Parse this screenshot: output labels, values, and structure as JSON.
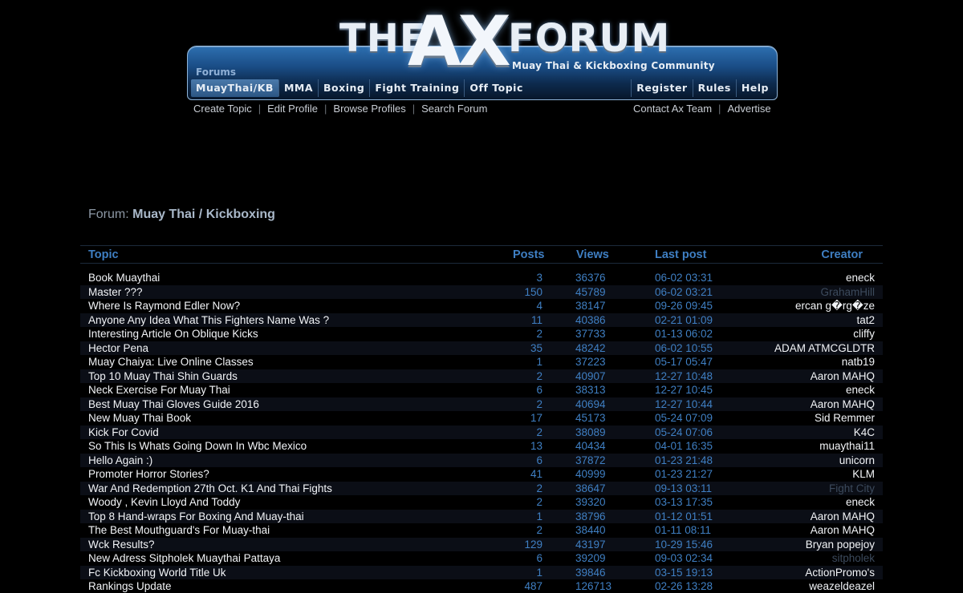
{
  "header": {
    "logo_the": "THE",
    "logo_ax": "AX",
    "logo_forum": "FORUM",
    "tagline": "Muay Thai & Kickboxing Community",
    "forums_label": "Forums",
    "nav_left": [
      "MuayThai/KB",
      "MMA",
      "Boxing",
      "Fight Training",
      "Off Topic"
    ],
    "nav_right": [
      "Register",
      "Rules",
      "Help"
    ],
    "active_nav": "MuayThai/KB"
  },
  "sublinks": {
    "left": [
      "Create Topic",
      "Edit Profile",
      "Browse Profiles",
      "Search Forum"
    ],
    "right": [
      "Contact Ax Team",
      "Advertise"
    ],
    "separator": "|"
  },
  "forum": {
    "prefix": "Forum: ",
    "name": "Muay Thai / Kickboxing"
  },
  "table": {
    "headers": {
      "topic": "Topic",
      "posts": "Posts",
      "views": "Views",
      "last_post": "Last post",
      "creator": "Creator"
    },
    "rows": [
      {
        "topic": "Book Muaythai",
        "posts": "3",
        "views": "36376",
        "last_post": "06-02 03:31",
        "creator": "eneck",
        "dim": false
      },
      {
        "topic": "Master ???",
        "posts": "150",
        "views": "45789",
        "last_post": "06-02 03:21",
        "creator": "GrahamHill",
        "dim": true
      },
      {
        "topic": "Where Is Raymond Edler Now?",
        "posts": "4",
        "views": "38147",
        "last_post": "09-26 09:45",
        "creator": "ercan g�rg�ze",
        "dim": false
      },
      {
        "topic": "Anyone Any Idea What This Fighters Name Was ?",
        "posts": "11",
        "views": "40386",
        "last_post": "02-21 01:09",
        "creator": "tat2",
        "dim": false
      },
      {
        "topic": "Interesting Article On Oblique Kicks",
        "posts": "2",
        "views": "37733",
        "last_post": "01-13 06:02",
        "creator": "cliffy",
        "dim": false
      },
      {
        "topic": "Hector Pena",
        "posts": "35",
        "views": "48242",
        "last_post": "06-02 10:55",
        "creator": "ADAM ATMCGLDTR",
        "dim": false
      },
      {
        "topic": "Muay Chaiya: Live Online Classes",
        "posts": "1",
        "views": "37223",
        "last_post": "05-17 05:47",
        "creator": "natb19",
        "dim": false
      },
      {
        "topic": "Top 10 Muay Thai Shin Guards",
        "posts": "2",
        "views": "40907",
        "last_post": "12-27 10:48",
        "creator": "Aaron MAHQ",
        "dim": false
      },
      {
        "topic": "Neck Exercise For Muay Thai",
        "posts": "6",
        "views": "38313",
        "last_post": "12-27 10:45",
        "creator": "eneck",
        "dim": false
      },
      {
        "topic": "Best Muay Thai Gloves Guide 2016",
        "posts": "2",
        "views": "40694",
        "last_post": "12-27 10:44",
        "creator": "Aaron MAHQ",
        "dim": false
      },
      {
        "topic": "New Muay Thai Book",
        "posts": "17",
        "views": "45173",
        "last_post": "05-24 07:09",
        "creator": "Sid Remmer",
        "dim": false
      },
      {
        "topic": "Kick For Covid",
        "posts": "2",
        "views": "38089",
        "last_post": "05-24 07:06",
        "creator": "K4C",
        "dim": false
      },
      {
        "topic": "So This Is Whats Going Down In Wbc Mexico",
        "posts": "13",
        "views": "40434",
        "last_post": "04-01 16:35",
        "creator": "muaythai11",
        "dim": false
      },
      {
        "topic": "Hello Again :)",
        "posts": "6",
        "views": "37872",
        "last_post": "01-23 21:48",
        "creator": "unicorn",
        "dim": false
      },
      {
        "topic": "Promoter Horror Stories?",
        "posts": "41",
        "views": "40999",
        "last_post": "01-23 21:27",
        "creator": "KLM",
        "dim": false
      },
      {
        "topic": "War And Redemption 27th Oct. K1 And Thai Fights",
        "posts": "2",
        "views": "38647",
        "last_post": "09-13 03:11",
        "creator": "Fight City",
        "dim": true
      },
      {
        "topic": "Woody , Kevin Lloyd And Toddy",
        "posts": "2",
        "views": "39320",
        "last_post": "03-13 17:35",
        "creator": "eneck",
        "dim": false
      },
      {
        "topic": "Top 8 Hand-wraps For Boxing And Muay-thai",
        "posts": "1",
        "views": "38796",
        "last_post": "01-12 01:51",
        "creator": "Aaron MAHQ",
        "dim": false
      },
      {
        "topic": "The Best Mouthguard's For Muay-thai",
        "posts": "2",
        "views": "38440",
        "last_post": "01-11 08:11",
        "creator": "Aaron MAHQ",
        "dim": false
      },
      {
        "topic": "Wck Results?",
        "posts": "129",
        "views": "43197",
        "last_post": "10-29 15:46",
        "creator": "Bryan popejoy",
        "dim": false
      },
      {
        "topic": "New Adress Sitpholek Muaythai Pattaya",
        "posts": "6",
        "views": "39209",
        "last_post": "09-03 02:34",
        "creator": "sitpholek",
        "dim": true
      },
      {
        "topic": "Fc Kickboxing World Title Uk",
        "posts": "1",
        "views": "39846",
        "last_post": "03-15 19:13",
        "creator": "ActionPromo's",
        "dim": false
      },
      {
        "topic": "Rankings Update",
        "posts": "487",
        "views": "126713",
        "last_post": "02-26 13:28",
        "creator": "weazeldeazel",
        "dim": false
      }
    ]
  }
}
